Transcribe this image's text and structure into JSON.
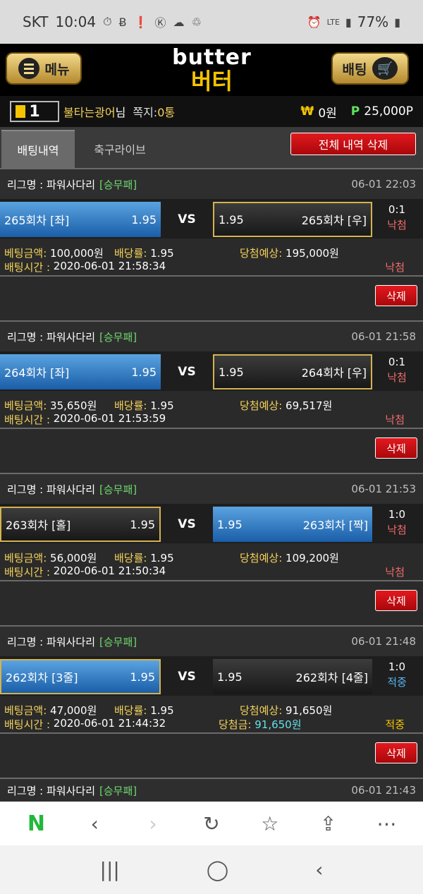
{
  "statusbar": {
    "carrier": "SKT",
    "time": "10:04",
    "network": "LTE",
    "battery": "77%"
  },
  "header": {
    "menu_label": "메뉴",
    "logo_en": "butter",
    "logo_ko": "버터",
    "bet_label": "배팅"
  },
  "user": {
    "level": "1",
    "name": "불타는광어",
    "suffix": "님",
    "note_label": "쪽지:",
    "note_value": "0통",
    "won_icon": "₩",
    "won": "0원",
    "point_icon": "P",
    "points": "25,000P"
  },
  "tabs": {
    "active": "배팅내역",
    "second": "축구라이브",
    "delete_all": "전체 내역 삭제"
  },
  "labels": {
    "league": "리그명 : ",
    "vs": "VS",
    "bet_amount": "베팅금액: ",
    "odds": "배당률: ",
    "expected": "당첨예상: ",
    "bet_time": "배팅시간 : ",
    "win_amount": "당첨금: ",
    "delete": "삭제"
  },
  "entries": [
    {
      "league": "파워사다리",
      "tag": "[승무패]",
      "datetime": "06-01 22:03",
      "left": "265회차 [좌]",
      "left_odds": "1.95",
      "right_odds": "1.95",
      "right": "265회차 [우]",
      "score": "0:1",
      "result": "낙첨",
      "amount": "100,000원",
      "odds": "1.95",
      "expected": "195,000원",
      "time": "2020-06-01 21:58:34",
      "status": "낙첨"
    },
    {
      "league": "파워사다리",
      "tag": "[승무패]",
      "datetime": "06-01 21:58",
      "left": "264회차 [좌]",
      "left_odds": "1.95",
      "right_odds": "1.95",
      "right": "264회차 [우]",
      "score": "0:1",
      "result": "낙첨",
      "amount": "35,650원",
      "odds": "1.95",
      "expected": "69,517원",
      "time": "2020-06-01 21:53:59",
      "status": "낙첨"
    },
    {
      "league": "파워사다리",
      "tag": "[승무패]",
      "datetime": "06-01 21:53",
      "left": "263회차 [홀]",
      "left_odds": "1.95",
      "right_odds": "1.95",
      "right": "263회차 [짝]",
      "score": "1:0",
      "result": "낙첨",
      "amount": "56,000원",
      "odds": "1.95",
      "expected": "109,200원",
      "time": "2020-06-01 21:50:34",
      "status": "낙첨"
    },
    {
      "league": "파워사다리",
      "tag": "[승무패]",
      "datetime": "06-01 21:48",
      "left": "262회차 [3줄]",
      "left_odds": "1.95",
      "right_odds": "1.95",
      "right": "262회차 [4줄]",
      "score": "1:0",
      "result": "적중",
      "amount": "47,000원",
      "odds": "1.95",
      "expected": "91,650원",
      "time": "2020-06-01 21:44:32",
      "win_amount": "91,650원",
      "status": "적중"
    }
  ],
  "last_entry": {
    "league": "파워사다리",
    "tag": "[승무패]",
    "datetime": "06-01 21:43"
  },
  "colors": {
    "selected": "#1a5ea8",
    "lose": "#f26b6b",
    "win": "#58b6f2",
    "tag": "#6fd86f",
    "gold": "#f5c400"
  }
}
